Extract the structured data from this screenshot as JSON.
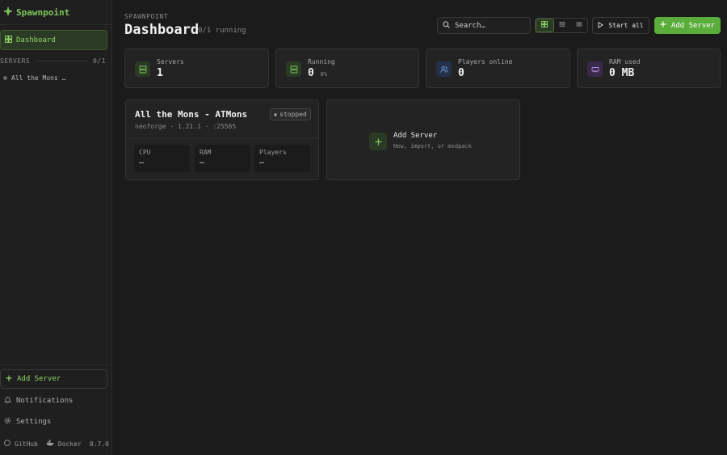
{
  "app": {
    "name": "Spawnpoint",
    "version": "0.7.0",
    "accent": "#5aad3a"
  },
  "sidebar": {
    "nav_dashboard": "Dashboard",
    "servers_heading": "SERVERS",
    "servers_count": "0/1",
    "servers": [
      {
        "name": "All the Mons …",
        "status": "stopped"
      }
    ],
    "add_server": "Add Server",
    "notifications": "Notifications",
    "settings": "Settings",
    "footer": {
      "github": "GitHub",
      "docker": "Docker",
      "version": "0.7.0"
    }
  },
  "header": {
    "breadcrumb": "SPAWNPOINT",
    "title": "Dashboard",
    "subtitle": "0/1 running",
    "search_placeholder": "Search…",
    "start_all": "Start all",
    "add_server": "Add Server",
    "view_modes": [
      "grid",
      "compact-list",
      "list"
    ],
    "active_view": "grid"
  },
  "stats": [
    {
      "label": "Servers",
      "value": "1",
      "suffix": "",
      "icon": "server-icon",
      "color": "#5aad3a"
    },
    {
      "label": "Running",
      "value": "0",
      "suffix": "0%",
      "icon": "server-icon",
      "color": "#5aad3a"
    },
    {
      "label": "Players online",
      "value": "0",
      "suffix": "",
      "icon": "users-icon",
      "color": "#5b8fd9"
    },
    {
      "label": "RAM used",
      "value": "0 MB",
      "suffix": "",
      "icon": "memory-icon",
      "color": "#a070d8"
    }
  ],
  "server_card": {
    "name": "All the Mons - ATMons",
    "meta": "neoforge · 1.21.1 · :25565",
    "status": "stopped",
    "metrics": [
      {
        "label": "CPU",
        "value": "—"
      },
      {
        "label": "RAM",
        "value": "—"
      },
      {
        "label": "Players",
        "value": "—"
      }
    ]
  },
  "add_card": {
    "title": "Add Server",
    "subtitle": "New, import, or modpack"
  }
}
